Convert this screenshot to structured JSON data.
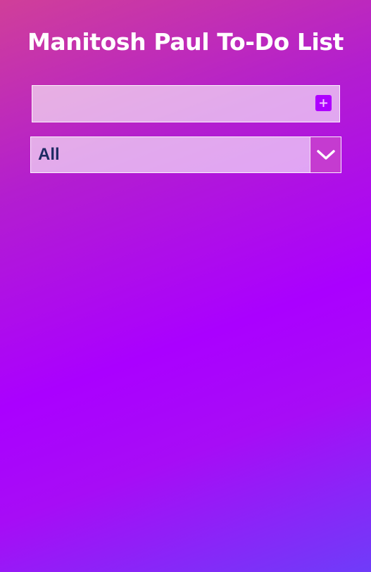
{
  "header": {
    "title": "Manitosh Paul To-Do List"
  },
  "todo_form": {
    "input_value": "",
    "input_placeholder": "",
    "add_button_icon": "plus-square-icon"
  },
  "filter": {
    "selected": "All",
    "dropdown_icon": "chevron-down-icon"
  },
  "colors": {
    "accent": "#aa00ff",
    "text_dark": "#1e2b63",
    "title_text": "#ffffff"
  }
}
